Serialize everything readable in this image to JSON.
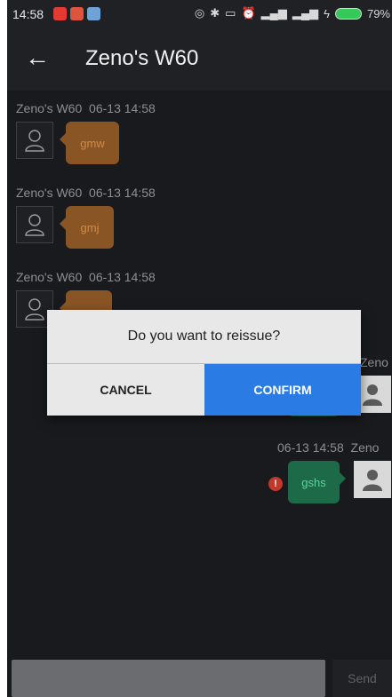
{
  "status_bar": {
    "time": "14:58",
    "battery_text": "79%"
  },
  "app_bar": {
    "title": "Zeno's W60"
  },
  "messages": [
    {
      "sender": "Zeno's W60",
      "timestamp": "06-13 14:58",
      "text": "gmw",
      "side": "left"
    },
    {
      "sender": "Zeno's W60",
      "timestamp": "06-13 14:58",
      "text": "gmj",
      "side": "left"
    },
    {
      "sender": "Zeno's W60",
      "timestamp": "06-13 14:58",
      "text": "",
      "side": "left"
    },
    {
      "sender": "Zeno",
      "timestamp": "",
      "text": "",
      "side": "right"
    },
    {
      "sender": "Zeno",
      "timestamp": "06-13 14:58",
      "text": "gshs",
      "side": "right",
      "error": "!"
    }
  ],
  "input": {
    "placeholder": "",
    "send_label": "Send"
  },
  "dialog": {
    "message": "Do you want to reissue?",
    "cancel_label": "CANCEL",
    "confirm_label": "CONFIRM"
  },
  "colors": {
    "left_bubble": "#8a5524",
    "right_bubble": "#1d6a48",
    "confirm": "#2a7be4",
    "background": "#181a1e"
  }
}
